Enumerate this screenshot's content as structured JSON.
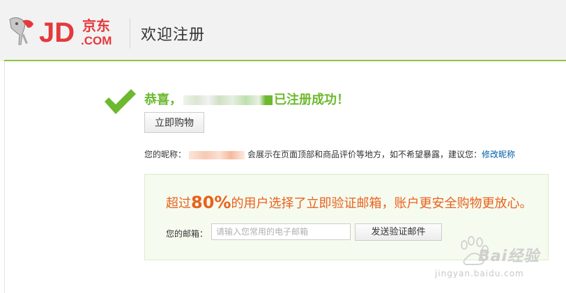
{
  "header": {
    "logo_text": "JD",
    "logo_cn": "京东",
    "logo_sub": ".COM",
    "title": "欢迎注册"
  },
  "success": {
    "prefix": "恭喜，",
    "suffix": "已注册成功！"
  },
  "buttons": {
    "shop_now": "立即购物",
    "send_verify": "发送验证邮件"
  },
  "nickname": {
    "label": "您的昵称：",
    "note": "会展示在页面顶部和商品评价等地方，如不希望暴露，建议您：",
    "link": "修改昵称"
  },
  "verify": {
    "promo_pre": "超过",
    "promo_pct": "80%",
    "promo_post": "的用户选择了立即验证邮箱，账户更安全购物更放心。",
    "email_label": "您的邮箱：",
    "email_placeholder": "请输入您常用的电子邮箱",
    "email_value": ""
  },
  "watermark": {
    "brand_pre": "Bai",
    "brand_post": "经验",
    "url": "jingyan.baidu.com"
  },
  "colors": {
    "accent_green": "#6cb92f",
    "header_rule": "#8dc63f",
    "promo_orange": "#e8621e",
    "link_blue": "#005ea7",
    "logo_red": "#e4393c"
  }
}
